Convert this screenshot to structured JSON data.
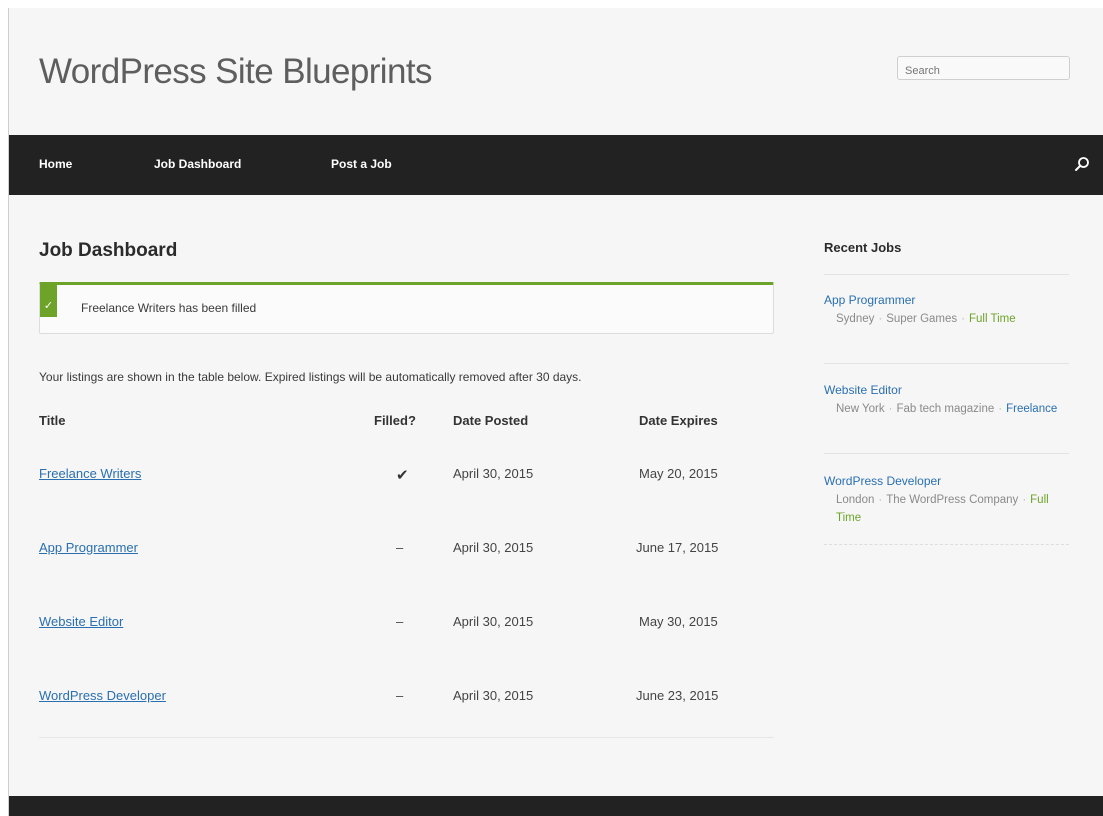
{
  "site": {
    "title": "WordPress Site Blueprints",
    "search_placeholder": "Search"
  },
  "nav": {
    "items": [
      "Home",
      "Job Dashboard",
      "Post a Job"
    ],
    "search_icon": "search-icon"
  },
  "main": {
    "heading": "Job Dashboard",
    "notice": "Freelance Writers has been filled",
    "notice_icon": "check-icon",
    "intro": "Your listings are shown in the table below. Expired listings will be automatically removed after 30 days.",
    "columns": [
      "Title",
      "Filled?",
      "Date Posted",
      "Date Expires"
    ],
    "rows": [
      {
        "title": "Freelance Writers",
        "filled": "✔",
        "posted": "April 30, 2015",
        "expires": "May 20, 2015"
      },
      {
        "title": "App Programmer",
        "filled": "–",
        "posted": "April 30, 2015",
        "expires": "June 17, 2015"
      },
      {
        "title": "Website Editor",
        "filled": "–",
        "posted": "April 30, 2015",
        "expires": "May 30, 2015"
      },
      {
        "title": "WordPress Developer",
        "filled": "–",
        "posted": "April 30, 2015",
        "expires": "June 23, 2015"
      }
    ]
  },
  "sidebar": {
    "title": "Recent Jobs",
    "jobs": [
      {
        "title": "App Programmer",
        "location": "Sydney",
        "company": "Super Games",
        "type": "Full Time"
      },
      {
        "title": "Website Editor",
        "location": "New York",
        "company": "Fab tech magazine",
        "type": "Freelance"
      },
      {
        "title": "WordPress Developer",
        "location": "London",
        "company": "The WordPress Company",
        "type": "Full Time"
      }
    ],
    "separator": "·"
  },
  "colors": {
    "nav_bg": "#222222",
    "accent_green": "#6ea32a",
    "link_blue": "#2a6fb0"
  }
}
